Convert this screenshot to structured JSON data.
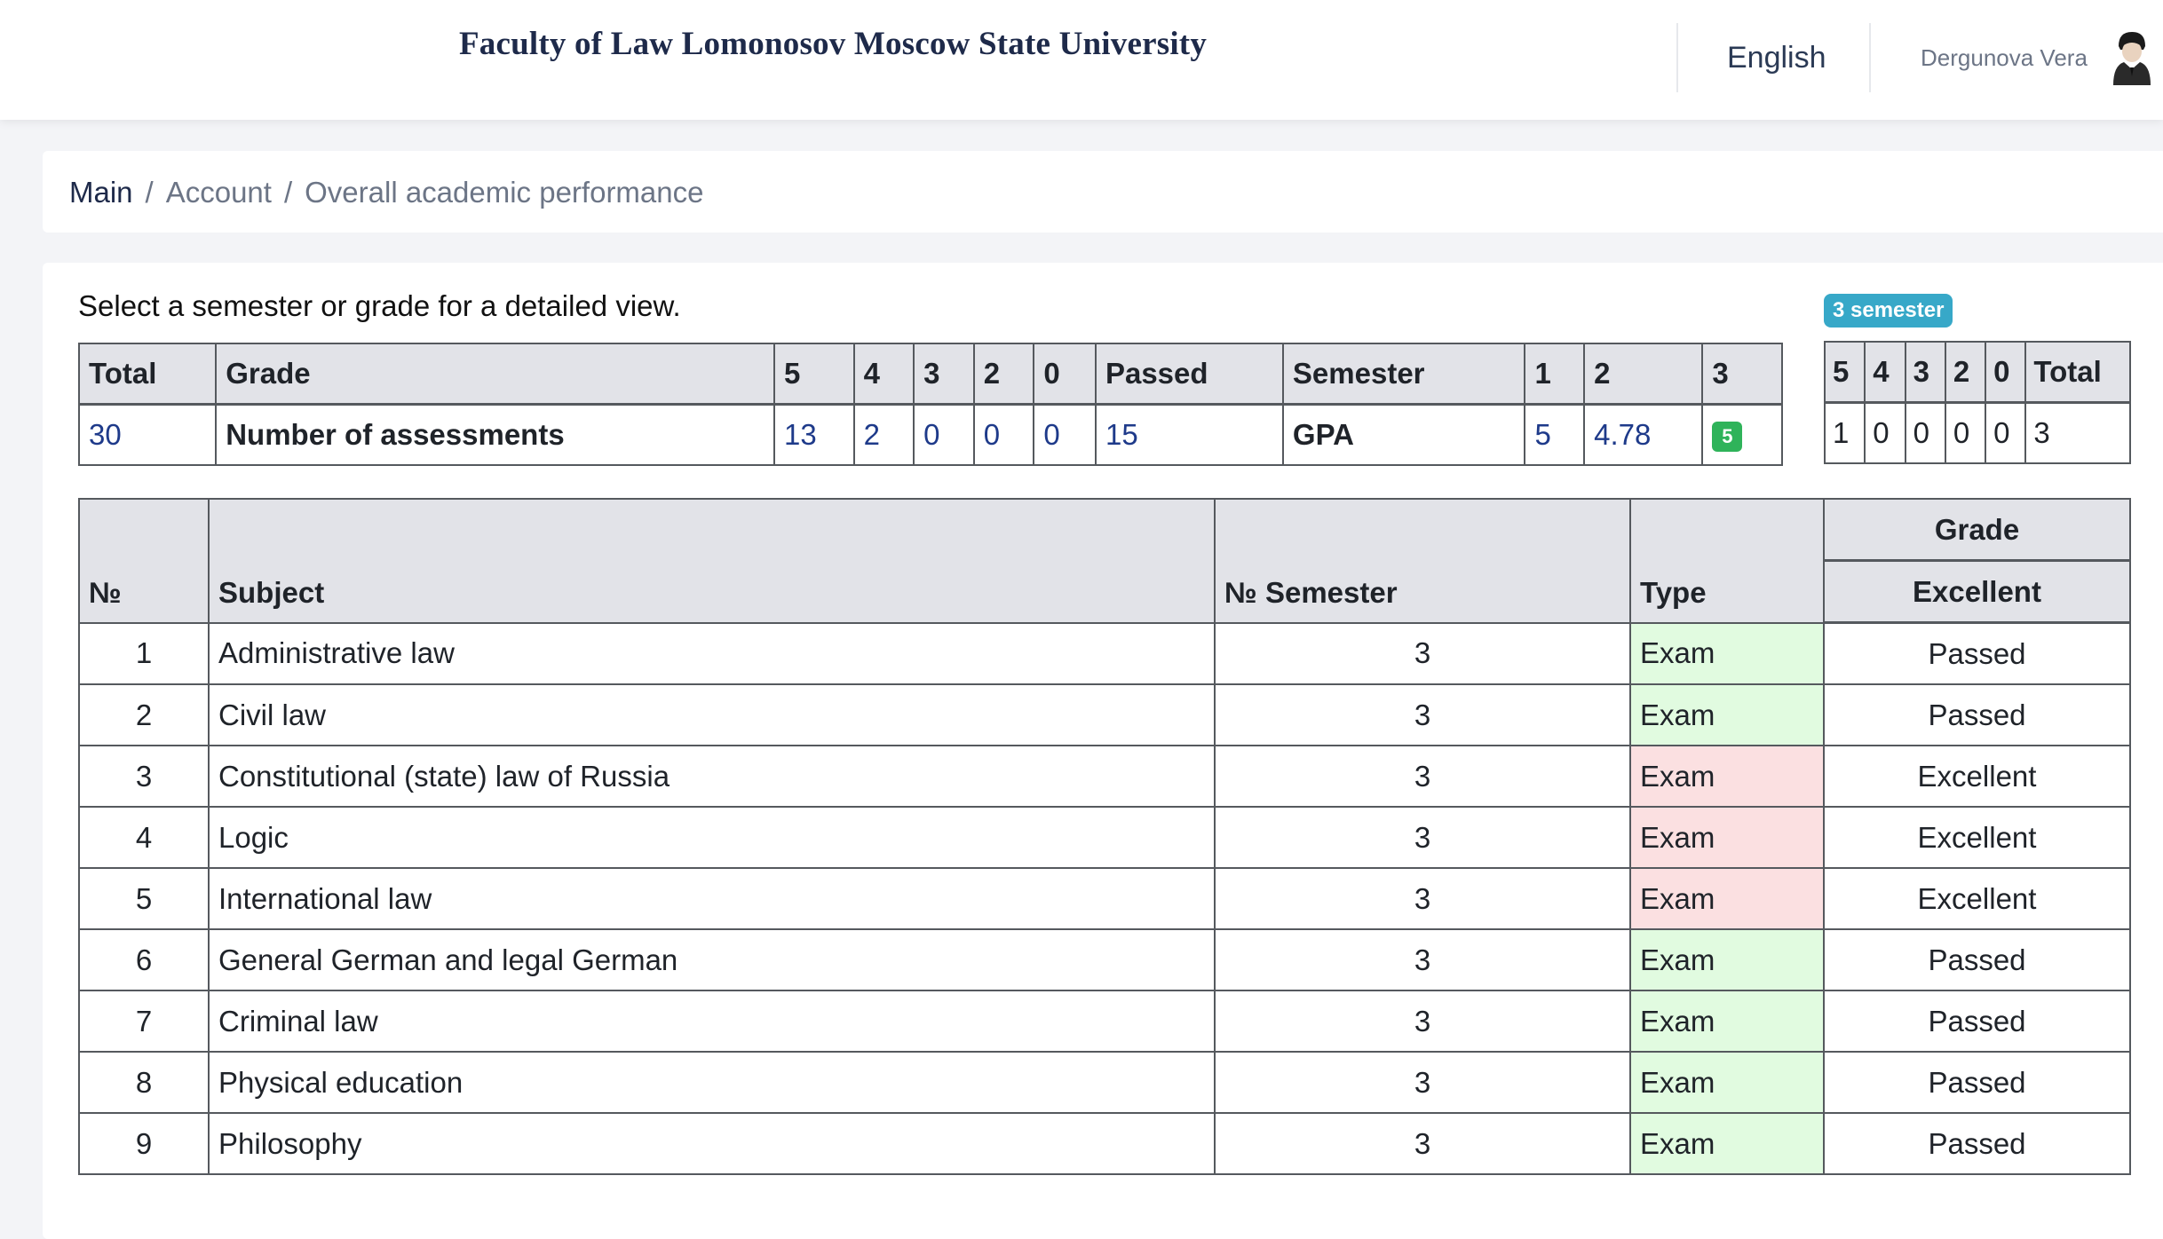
{
  "header": {
    "title": "Faculty of Law Lomonosov Moscow State University",
    "language": "English",
    "user_name": "Dergunova Vera"
  },
  "breadcrumb": {
    "main": "Main",
    "account": "Account",
    "current": "Overall academic performance",
    "separator": "/"
  },
  "intro_text": "Select a semester or grade for a detailed view.",
  "semester_badge": "3 semester",
  "summary": {
    "headers": [
      "Total",
      "Grade",
      "5",
      "4",
      "3",
      "2",
      "0",
      "Passed",
      "Semester",
      "1",
      "2",
      "3"
    ],
    "row": {
      "total": "30",
      "label": "Number of assessments",
      "g5": "13",
      "g4": "2",
      "g3": "0",
      "g2": "0",
      "g0": "0",
      "passed": "15",
      "gpa_label": "GPA",
      "s1": "5",
      "s2": "4.78",
      "s3": "5"
    }
  },
  "semester_summary": {
    "headers": [
      "5",
      "4",
      "3",
      "2",
      "0",
      "Total"
    ],
    "values": [
      "1",
      "0",
      "0",
      "0",
      "0",
      "3"
    ]
  },
  "grades_table": {
    "headers": {
      "no": "№",
      "subject": "Subject",
      "semester": "№ Semester",
      "type": "Type",
      "grade_group": "Grade",
      "grade_sub": "Excellent"
    },
    "rows": [
      {
        "no": "1",
        "subject": "Administrative law",
        "semester": "3",
        "type": "Exam",
        "grade": "Passed"
      },
      {
        "no": "2",
        "subject": "Civil law",
        "semester": "3",
        "type": "Exam",
        "grade": "Passed"
      },
      {
        "no": "3",
        "subject": "Constitutional (state) law of Russia",
        "semester": "3",
        "type": "Exam",
        "grade": "Excellent"
      },
      {
        "no": "4",
        "subject": "Logic",
        "semester": "3",
        "type": "Exam",
        "grade": "Excellent"
      },
      {
        "no": "5",
        "subject": "International law",
        "semester": "3",
        "type": "Exam",
        "grade": "Excellent"
      },
      {
        "no": "6",
        "subject": "General German and legal German",
        "semester": "3",
        "type": "Exam",
        "grade": "Passed"
      },
      {
        "no": "7",
        "subject": "Criminal law",
        "semester": "3",
        "type": "Exam",
        "grade": "Passed"
      },
      {
        "no": "8",
        "subject": "Physical education",
        "semester": "3",
        "type": "Exam",
        "grade": "Passed"
      },
      {
        "no": "9",
        "subject": "Philosophy",
        "semester": "3",
        "type": "Exam",
        "grade": "Passed"
      }
    ]
  },
  "colors": {
    "type_passed_bg": "#e1fbe0",
    "type_excellent_bg": "#fbe0e1",
    "badge_bg": "#37a8c8",
    "grade_badge_bg": "#2fb35a"
  },
  "icons": {
    "avatar": "user-avatar-icon"
  }
}
